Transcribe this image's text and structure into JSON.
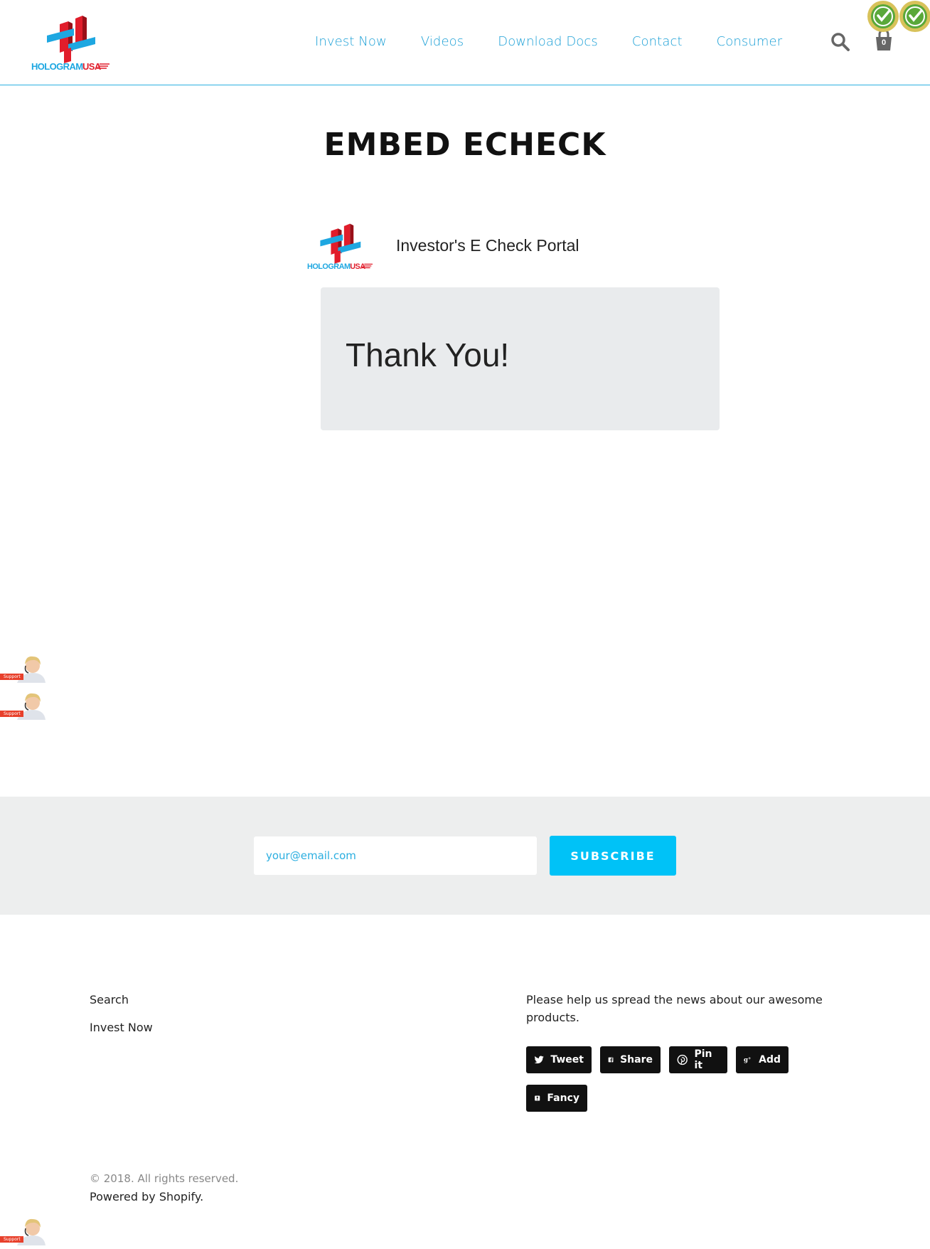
{
  "header": {
    "logo_text_hologram": "HOLOGRAM",
    "logo_text_usa": "USA",
    "nav": [
      {
        "label": "Invest Now"
      },
      {
        "label": "Videos"
      },
      {
        "label": "Download Docs"
      },
      {
        "label": "Contact"
      },
      {
        "label": "Consumer"
      }
    ],
    "cart_count": "0",
    "icons": [
      "search-icon",
      "cart-icon",
      "trust-badge-icon"
    ]
  },
  "main": {
    "page_title": "EMBED ECHECK",
    "portal_title": "Investor's E Check Portal",
    "thank_you": "Thank You!"
  },
  "support_widget": {
    "label": "Support"
  },
  "newsletter": {
    "email_placeholder": "your@email.com",
    "email_value": "",
    "subscribe_label": "SUBSCRIBE"
  },
  "footer": {
    "links": [
      {
        "label": "Search"
      },
      {
        "label": "Invest Now"
      }
    ],
    "share_text": "Please help us spread the news about our awesome products.",
    "share_buttons": [
      {
        "label": "Tweet",
        "icon": "twitter-icon"
      },
      {
        "label": "Share",
        "icon": "facebook-icon"
      },
      {
        "label": "Pin it",
        "icon": "pinterest-icon"
      },
      {
        "label": "Add",
        "icon": "google-plus-icon"
      },
      {
        "label": "Fancy",
        "icon": "fancy-icon"
      }
    ],
    "copyright": "© 2018. All rights reserved.",
    "powered_prefix": "Powered by ",
    "powered_link": "Shopify",
    "powered_suffix": "."
  },
  "colors": {
    "accent": "#1a9fd6",
    "subscribe": "#00c2f7",
    "logo_red": "#e11d2b",
    "logo_blue": "#1ea7e1"
  }
}
